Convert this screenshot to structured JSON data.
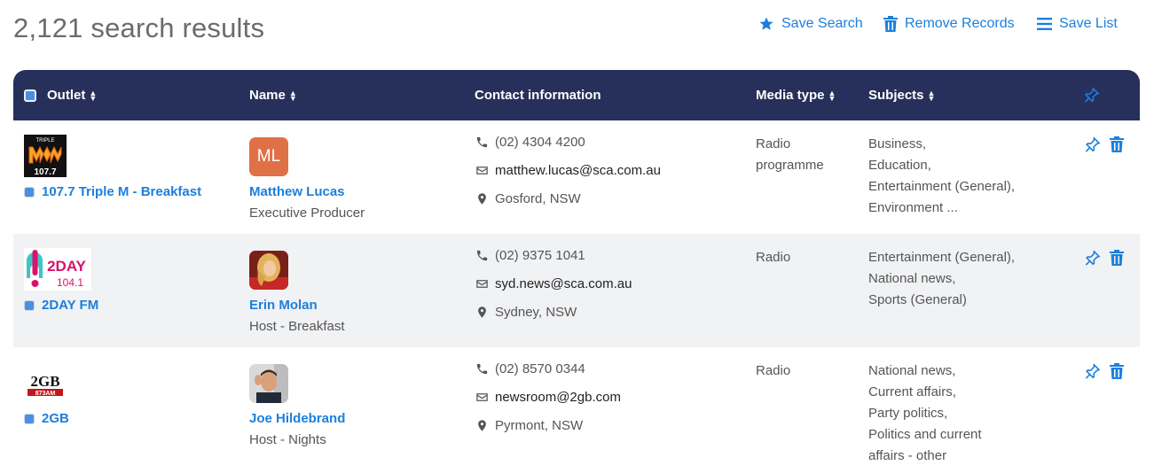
{
  "header": {
    "results_title": "2,121 search results",
    "actions": {
      "save_search": "Save Search",
      "remove_records": "Remove Records",
      "save_list": "Save List"
    }
  },
  "table": {
    "columns": {
      "outlet": "Outlet",
      "name": "Name",
      "contact": "Contact information",
      "media_type": "Media type",
      "subjects": "Subjects"
    },
    "rows": [
      {
        "logo_text_top": "TRIPLE",
        "logo_text_bottom": "107.7",
        "outlet": "107.7 Triple M - Breakfast",
        "avatar_initials": "ML",
        "name": "Matthew Lucas",
        "role": "Executive Producer",
        "phone": "(02) 4304 4200",
        "email": "matthew.lucas@sca.com.au",
        "location": "Gosford, NSW",
        "media_type": "Radio programme",
        "subjects": [
          "Business,",
          "Education,",
          "Entertainment (General),",
          "Environment ..."
        ]
      },
      {
        "logo_text_top": "2DAY",
        "logo_text_bottom": "104.1",
        "outlet": "2DAY FM",
        "name": "Erin Molan",
        "role": "Host - Breakfast",
        "phone": "(02) 9375 1041",
        "email": "syd.news@sca.com.au",
        "location": "Sydney, NSW",
        "media_type": "Radio",
        "subjects": [
          "Entertainment (General),",
          "National news,",
          "Sports (General)"
        ]
      },
      {
        "logo_text_top": "2GB",
        "logo_text_bottom": "873AM",
        "outlet": "2GB",
        "name": "Joe Hildebrand",
        "role": "Host - Nights",
        "phone": "(02) 8570 0344",
        "email": "newsroom@2gb.com",
        "location": "Pyrmont, NSW",
        "media_type": "Radio",
        "subjects": [
          "National news,",
          "Current affairs,",
          "Party politics,",
          "Politics and current",
          "affairs - other"
        ]
      }
    ]
  },
  "colors": {
    "header_bg": "#27305a",
    "link_blue": "#1b7fdc",
    "row_alt_bg": "#f1f2f4",
    "avatar_ml_bg": "#e07046"
  },
  "icons": [
    "star-icon",
    "trash-icon",
    "list-icon",
    "pin-icon",
    "phone-icon",
    "envelope-icon",
    "map-marker-icon",
    "sort-icon"
  ]
}
